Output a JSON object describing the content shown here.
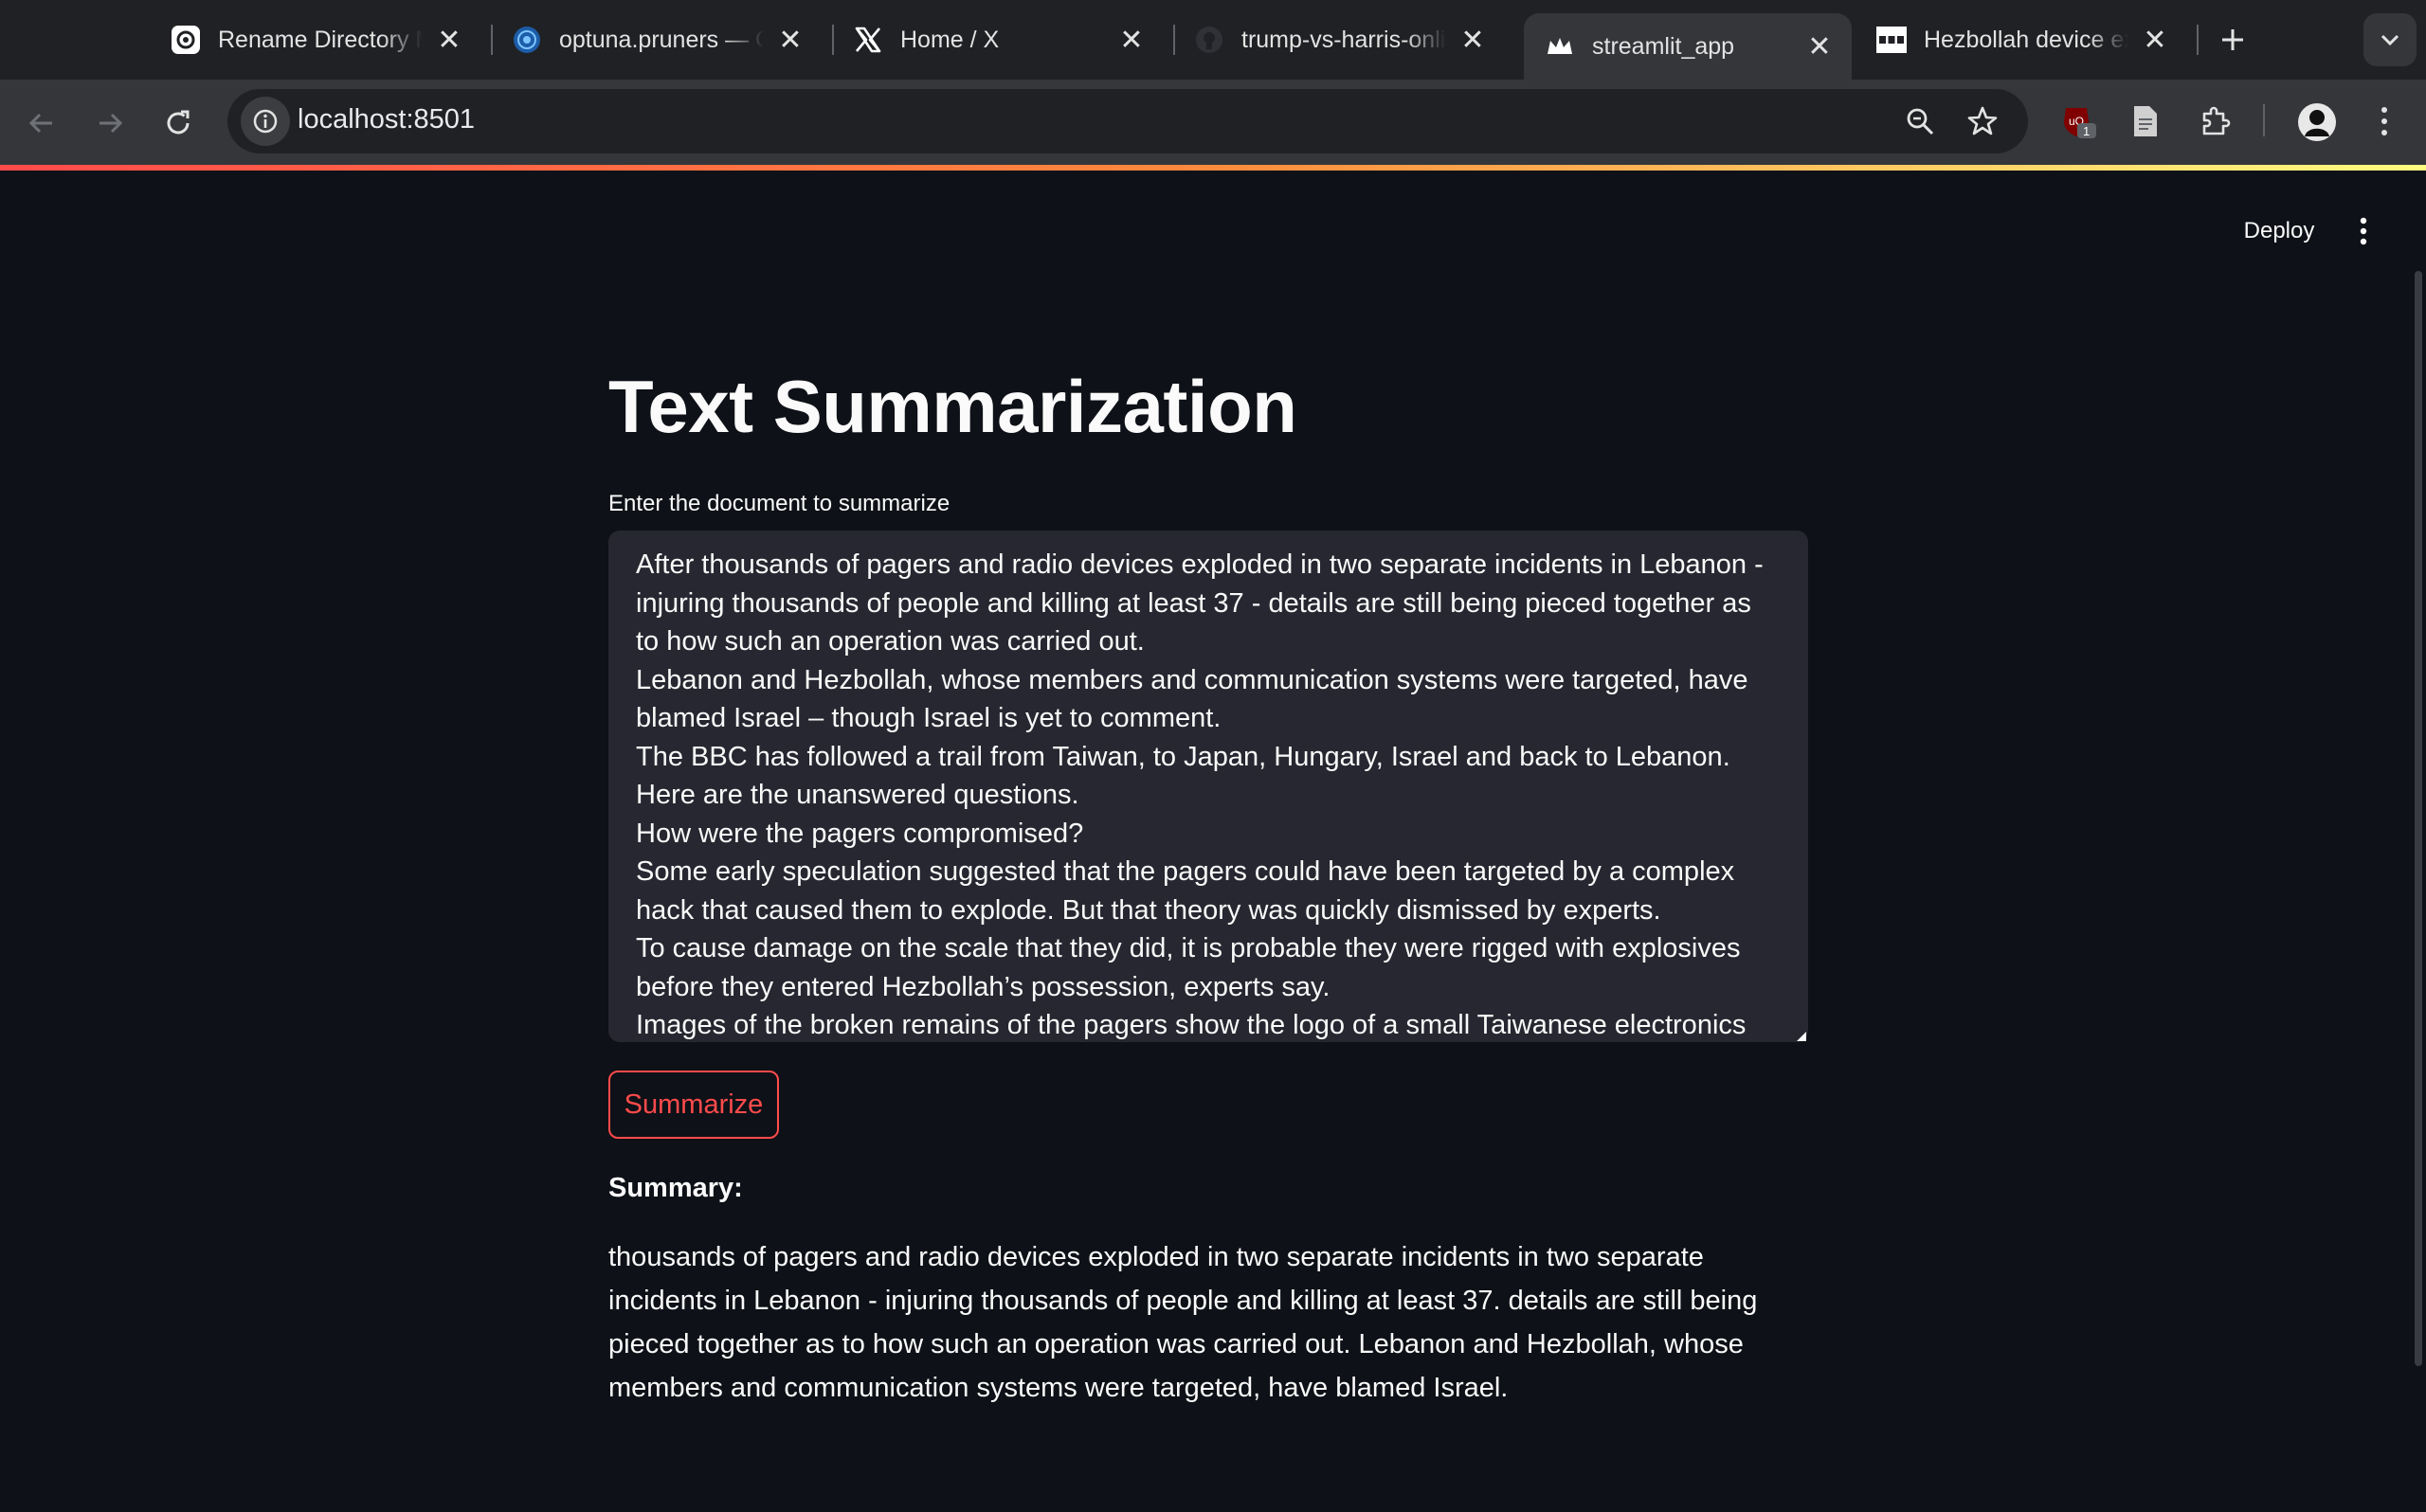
{
  "browser": {
    "tabs": [
      {
        "title": "Rename Directory Method",
        "favicon": "openai-icon",
        "active": false
      },
      {
        "title": "optuna.pruners — Optuna",
        "favicon": "optuna-icon",
        "active": false
      },
      {
        "title": "Home / X",
        "favicon": "x-logo-icon",
        "active": false
      },
      {
        "title": "trump-vs-harris-online",
        "favicon": "github-icon",
        "active": false
      },
      {
        "title": "streamlit_app",
        "favicon": "streamlit-crown-icon",
        "active": true
      },
      {
        "title": "Hezbollah device explosions",
        "favicon": "bbc-icon",
        "active": false
      }
    ],
    "url": "localhost:8501",
    "extension_badge": "1"
  },
  "app": {
    "header": {
      "deploy_label": "Deploy"
    },
    "title": "Text Summarization",
    "input": {
      "label": "Enter the document to summarize",
      "value": "After thousands of pagers and radio devices exploded in two separate incidents in Lebanon - injuring thousands of people and killing at least 37 - details are still being pieced together as to how such an operation was carried out.\nLebanon and Hezbollah, whose members and communication systems were targeted, have blamed Israel – though Israel is yet to comment.\nThe BBC has followed a trail from Taiwan, to Japan, Hungary, Israel and back to Lebanon.\nHere are the unanswered questions.\nHow were the pagers compromised?\nSome early speculation suggested that the pagers could have been targeted by a complex hack that caused them to explode. But that theory was quickly dismissed by experts.\nTo cause damage on the scale that they did, it is probable they were rigged with explosives before they entered Hezbollah’s possession, experts say.\nImages of the broken remains of the pagers show the logo of a small Taiwanese electronics"
    },
    "button": {
      "label": "Summarize"
    },
    "summary": {
      "heading": "Summary:",
      "text": "thousands of pagers and radio devices exploded in two separate incidents in two separate incidents in Lebanon - injuring thousands of people and killing at least 37. details are still being pieced together as to how such an operation was carried out. Lebanon and Hezbollah, whose members and communication systems were targeted, have blamed Israel."
    }
  },
  "colors": {
    "background": "#0e1117",
    "textarea_bg": "#262730",
    "accent": "#ff4b4b",
    "chrome_tabstrip": "#202124",
    "chrome_toolbar": "#35363a"
  }
}
